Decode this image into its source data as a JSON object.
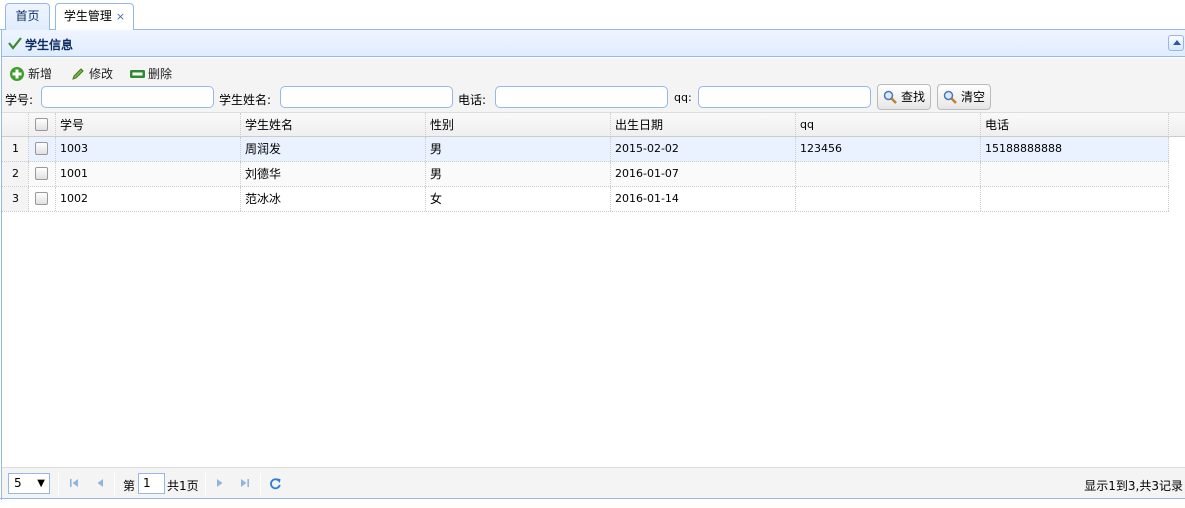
{
  "tabs": [
    {
      "label": "首页"
    },
    {
      "label": "学生管理",
      "close": "×"
    }
  ],
  "panel": {
    "title": "学生信息"
  },
  "toolbar": {
    "add_label": "新增",
    "edit_label": "修改",
    "delete_label": "删除"
  },
  "search": {
    "id_label": "学号:",
    "name_label": "学生姓名:",
    "phone_label": "电话:",
    "qq_label": "qq:",
    "id_value": "",
    "name_value": "",
    "phone_value": "",
    "qq_value": "",
    "search_button": "查找",
    "clear_button": "清空"
  },
  "grid": {
    "columns": [
      "学号",
      "学生姓名",
      "性别",
      "出生日期",
      "qq",
      "电话"
    ],
    "rows": [
      {
        "rownum": "1",
        "id": "1003",
        "name": "周润发",
        "gender": "男",
        "birth": "2015-02-02",
        "qq": "123456",
        "phone": "15188888888"
      },
      {
        "rownum": "2",
        "id": "1001",
        "name": "刘德华",
        "gender": "男",
        "birth": "2016-01-07",
        "qq": "",
        "phone": ""
      },
      {
        "rownum": "3",
        "id": "1002",
        "name": "范冰冰",
        "gender": "女",
        "birth": "2016-01-14",
        "qq": "",
        "phone": ""
      }
    ]
  },
  "pager": {
    "page_size": "5",
    "page_prefix": "第",
    "page_number": "1",
    "page_total": "共1页",
    "info": "显示1到3,共3记录"
  },
  "colors": {
    "accent": "#95b8e7",
    "header_bg": "#e0ecff",
    "selected_row": "#eaf2ff"
  }
}
